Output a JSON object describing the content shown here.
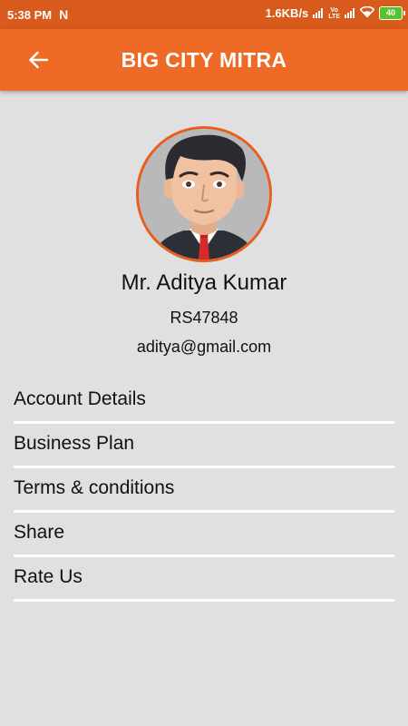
{
  "status_bar": {
    "time": "5:38 PM",
    "notification_icon": "N",
    "speed": "1.6KB/s",
    "volte": [
      "Vo",
      "LTE"
    ],
    "battery": "40"
  },
  "app_bar": {
    "title": "BIG CITY MITRA",
    "back_icon": "arrow-left-icon"
  },
  "profile": {
    "name": "Mr. Aditya Kumar",
    "id": "RS47848",
    "email": "aditya@gmail.com"
  },
  "menu": {
    "items": [
      {
        "label": "Account Details"
      },
      {
        "label": "Business Plan"
      },
      {
        "label": "Terms & conditions"
      },
      {
        "label": "Share"
      },
      {
        "label": "Rate Us"
      }
    ]
  },
  "colors": {
    "app_bar": "#ef6a26",
    "status_bar": "#d85a1c",
    "background": "#e0e0e0",
    "divider": "#ffffff",
    "avatar_border": "#e85e1e"
  }
}
